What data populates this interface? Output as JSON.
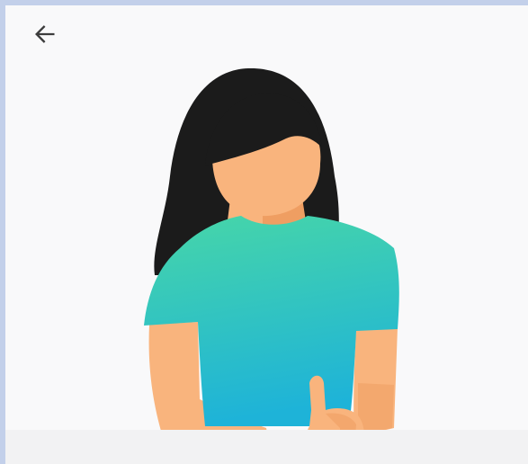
{
  "screen": {
    "background_color": "#f9f9fa",
    "border_color": "#c3d0ea"
  },
  "toolbar": {
    "back_icon": "arrow-left-icon"
  },
  "illustration": {
    "subject": "person-waving-illustration",
    "colors": {
      "hair": "#1b1b1b",
      "skin": "#f9b47d",
      "skin_shadow": "#ef9e62",
      "shirt_top": "#47d6a8",
      "shirt_bottom": "#1eb3d8"
    }
  },
  "bottom_panel": {
    "color": "#f2f2f3"
  }
}
